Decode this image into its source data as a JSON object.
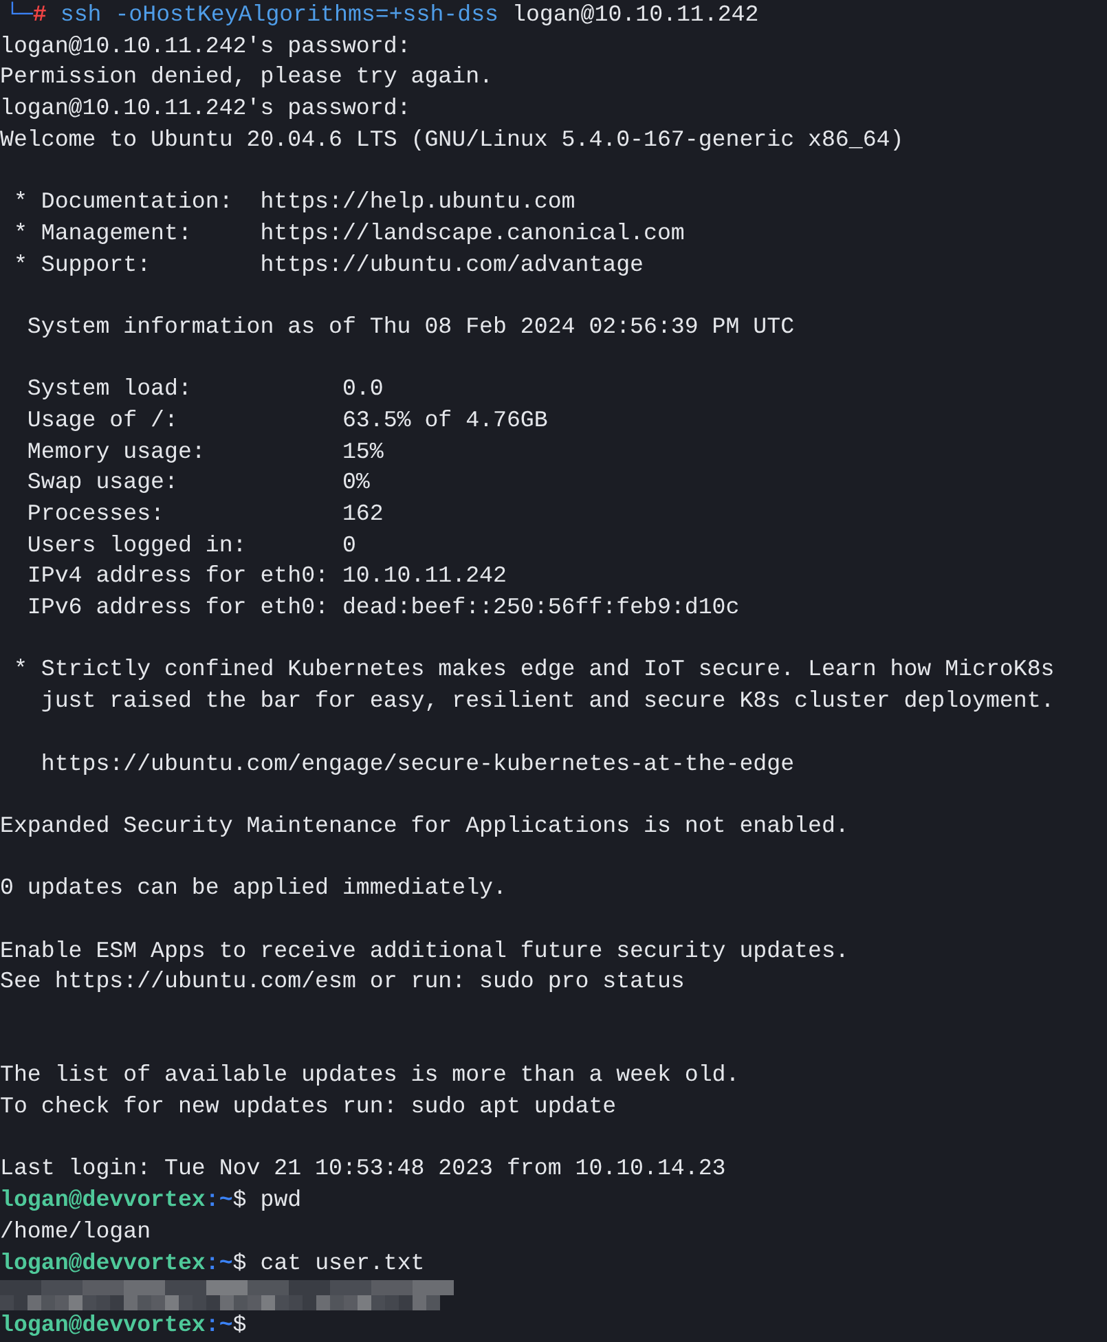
{
  "terminal": {
    "lines": [
      {
        "kind": "root-prompt",
        "corner": "└─",
        "symbol": "#",
        "command": "ssh -oHostKeyAlgorithms=+ssh-dss",
        "argument": "logan@10.10.11.242"
      },
      {
        "kind": "text",
        "text": "logan@10.10.11.242's password:"
      },
      {
        "kind": "text",
        "text": "Permission denied, please try again."
      },
      {
        "kind": "text",
        "text": "logan@10.10.11.242's password:"
      },
      {
        "kind": "text",
        "text": "Welcome to Ubuntu 20.04.6 LTS (GNU/Linux 5.4.0-167-generic x86_64)"
      },
      {
        "kind": "blank"
      },
      {
        "kind": "text",
        "text": " * Documentation:  https://help.ubuntu.com"
      },
      {
        "kind": "text",
        "text": " * Management:     https://landscape.canonical.com"
      },
      {
        "kind": "text",
        "text": " * Support:        https://ubuntu.com/advantage"
      },
      {
        "kind": "blank"
      },
      {
        "kind": "text",
        "text": "  System information as of Thu 08 Feb 2024 02:56:39 PM UTC"
      },
      {
        "kind": "blank"
      },
      {
        "kind": "text",
        "text": "  System load:           0.0"
      },
      {
        "kind": "text",
        "text": "  Usage of /:            63.5% of 4.76GB"
      },
      {
        "kind": "text",
        "text": "  Memory usage:          15%"
      },
      {
        "kind": "text",
        "text": "  Swap usage:            0%"
      },
      {
        "kind": "text",
        "text": "  Processes:             162"
      },
      {
        "kind": "text",
        "text": "  Users logged in:       0"
      },
      {
        "kind": "text",
        "text": "  IPv4 address for eth0: 10.10.11.242"
      },
      {
        "kind": "text",
        "text": "  IPv6 address for eth0: dead:beef::250:56ff:feb9:d10c"
      },
      {
        "kind": "blank"
      },
      {
        "kind": "text",
        "text": " * Strictly confined Kubernetes makes edge and IoT secure. Learn how MicroK8s"
      },
      {
        "kind": "text",
        "text": "   just raised the bar for easy, resilient and secure K8s cluster deployment."
      },
      {
        "kind": "blank"
      },
      {
        "kind": "text",
        "text": "   https://ubuntu.com/engage/secure-kubernetes-at-the-edge"
      },
      {
        "kind": "blank"
      },
      {
        "kind": "text",
        "text": "Expanded Security Maintenance for Applications is not enabled."
      },
      {
        "kind": "blank"
      },
      {
        "kind": "text",
        "text": "0 updates can be applied immediately."
      },
      {
        "kind": "blank"
      },
      {
        "kind": "text",
        "text": "Enable ESM Apps to receive additional future security updates."
      },
      {
        "kind": "text",
        "text": "See https://ubuntu.com/esm or run: sudo pro status"
      },
      {
        "kind": "blank"
      },
      {
        "kind": "blank"
      },
      {
        "kind": "text",
        "text": "The list of available updates is more than a week old."
      },
      {
        "kind": "text",
        "text": "To check for new updates run: sudo apt update"
      },
      {
        "kind": "blank"
      },
      {
        "kind": "text",
        "text": "Last login: Tue Nov 21 10:53:48 2023 from 10.10.14.23"
      },
      {
        "kind": "prompt",
        "user": "logan@devvortex",
        "path": ":~",
        "symbol": "$",
        "command": "pwd"
      },
      {
        "kind": "text",
        "text": "/home/logan"
      },
      {
        "kind": "prompt",
        "user": "logan@devvortex",
        "path": ":~",
        "symbol": "$",
        "command": "cat user.txt"
      },
      {
        "kind": "redacted"
      },
      {
        "kind": "prompt",
        "user": "logan@devvortex",
        "path": ":~",
        "symbol": "$"
      }
    ]
  }
}
